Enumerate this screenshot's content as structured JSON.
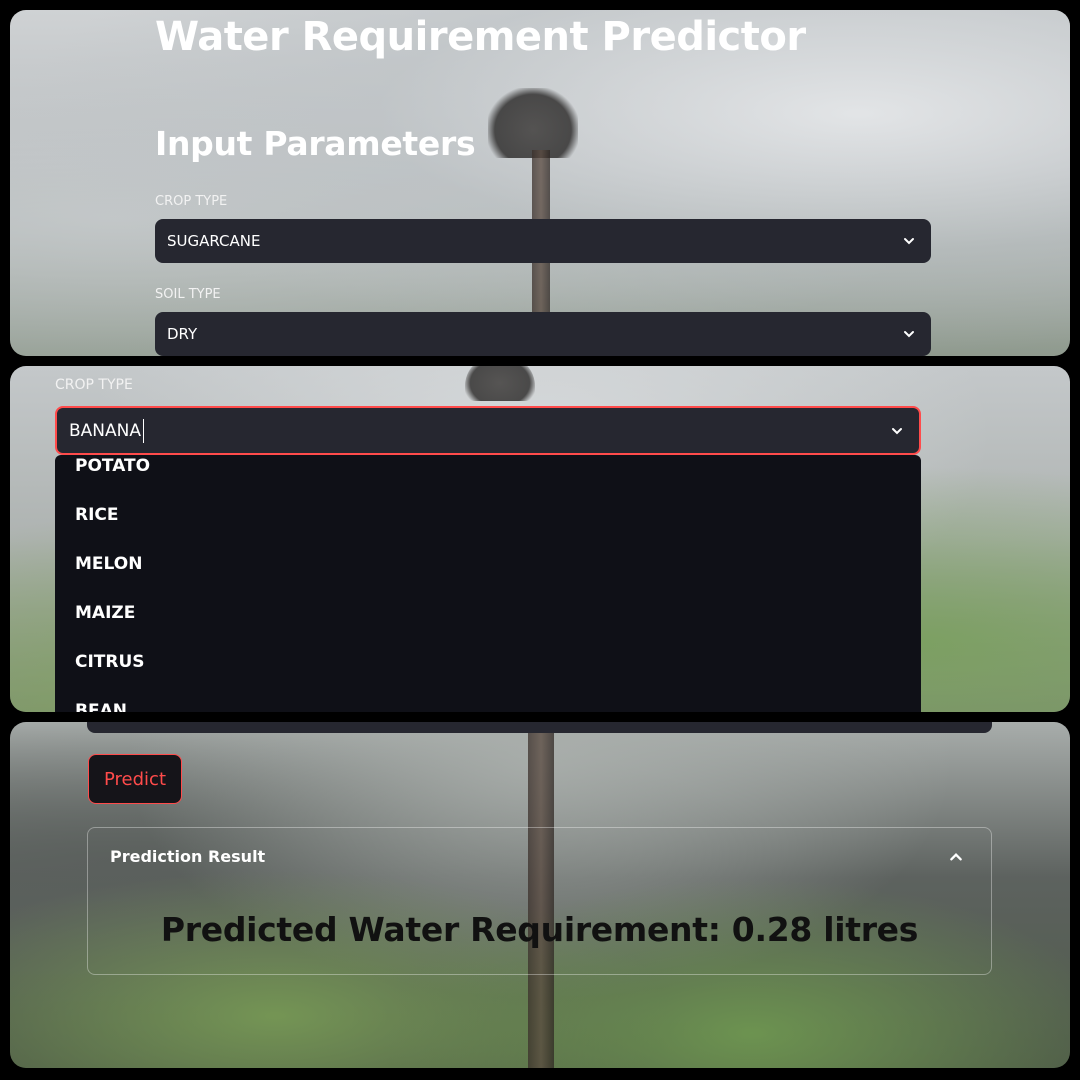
{
  "app": {
    "title": "Water Requirement Predictor"
  },
  "inputs": {
    "section_title": "Input Parameters",
    "crop_type": {
      "label": "CROP TYPE",
      "value": "SUGARCANE"
    },
    "soil_type": {
      "label": "SOIL TYPE",
      "value": "DRY"
    }
  },
  "crop_dropdown": {
    "label": "CROP TYPE",
    "typed_value": "BANANA",
    "options": [
      "POTATO",
      "RICE",
      "MELON",
      "MAIZE",
      "CITRUS",
      "BEAN"
    ]
  },
  "actions": {
    "predict_label": "Predict"
  },
  "result": {
    "header": "Prediction Result",
    "text": "Predicted Water Requirement: 0.28 litres"
  },
  "colors": {
    "accent": "#ff4b4b",
    "select_bg": "#262730",
    "dropdown_bg": "#0f1017"
  },
  "icons": {
    "select_chevron": "chevron-down-icon",
    "expander_chevron": "chevron-up-icon"
  }
}
